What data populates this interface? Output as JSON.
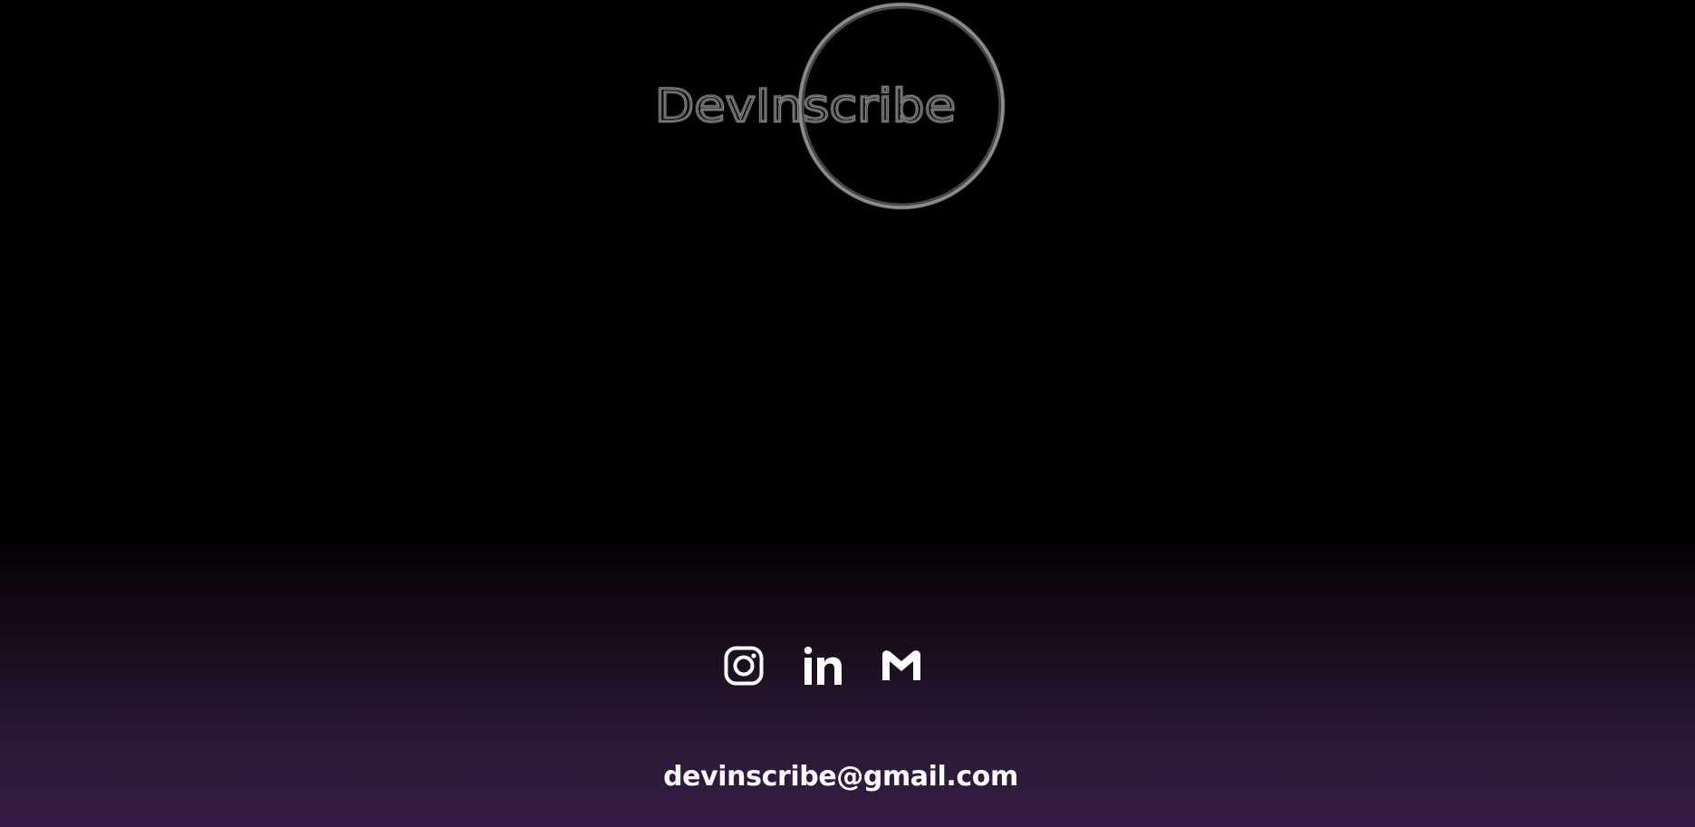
{
  "brand": {
    "logo_text": "DevInscribe",
    "logo_icon": "circle-logo-icon"
  },
  "social": {
    "items": [
      {
        "label": "Instagram",
        "icon": "instagram-icon"
      },
      {
        "label": "LinkedIn",
        "icon": "linkedin-icon"
      },
      {
        "label": "Gmail",
        "icon": "gmail-icon"
      }
    ]
  },
  "contact": {
    "email": "devinscribe@gmail.com"
  },
  "colors": {
    "background": "#000000",
    "footer_gradient_top": "#000000",
    "footer_gradient_bottom": "#351b44",
    "logo_stroke": "#9a9a9a",
    "icon_color": "#ffffff",
    "text_color": "#ffffff"
  }
}
